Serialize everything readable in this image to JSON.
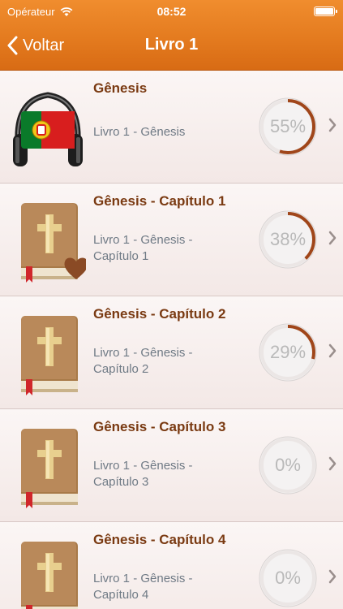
{
  "status_bar": {
    "carrier": "Opérateur",
    "time": "08:52"
  },
  "nav": {
    "back_label": "Voltar",
    "title": "Livro 1"
  },
  "colors": {
    "header": "#e47b1f",
    "title_text": "#7a3a12",
    "progress_arc": "#a0461a",
    "subtitle_text": "#6f7a85"
  },
  "items": [
    {
      "title": "Gênesis",
      "subtitle": "Livro 1 - Gênesis",
      "subtitle_line2": "",
      "progress": 55,
      "progress_label": "55%",
      "icon": "headphones-portugal-flag-icon",
      "favorite": false
    },
    {
      "title": "Gênesis - Capítulo 1",
      "subtitle": "Livro 1 - Gênesis -",
      "subtitle_line2": "Capítulo 1",
      "progress": 38,
      "progress_label": "38%",
      "icon": "bible-book-icon",
      "favorite": true
    },
    {
      "title": "Gênesis - Capítulo 2",
      "subtitle": "Livro 1 - Gênesis -",
      "subtitle_line2": "Capítulo 2",
      "progress": 29,
      "progress_label": "29%",
      "icon": "bible-book-icon",
      "favorite": false
    },
    {
      "title": "Gênesis - Capítulo 3",
      "subtitle": "Livro 1 - Gênesis -",
      "subtitle_line2": "Capítulo 3",
      "progress": 0,
      "progress_label": "0%",
      "icon": "bible-book-icon",
      "favorite": false
    },
    {
      "title": "Gênesis - Capítulo 4",
      "subtitle": "Livro 1 - Gênesis -",
      "subtitle_line2": "Capítulo 4",
      "progress": 0,
      "progress_label": "0%",
      "icon": "bible-book-icon",
      "favorite": false
    }
  ]
}
